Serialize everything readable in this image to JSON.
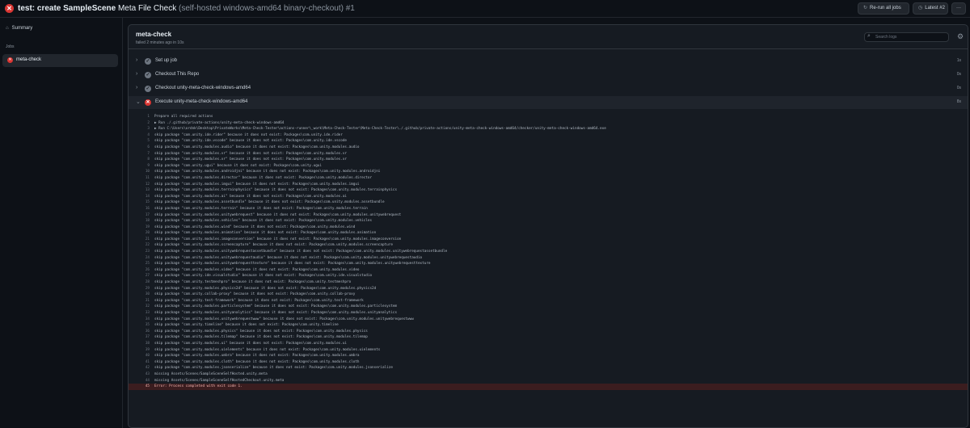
{
  "header": {
    "title_bold": "test: create SampleScene",
    "title_rest": "Meta File Check",
    "title_muted": "(self-hosted windows-amd64 binary-checkout) #1",
    "rerun_label": "Re-run all jobs",
    "latest_label": "Latest #2",
    "more_label": "···"
  },
  "sidebar": {
    "summary_label": "Summary",
    "jobs_label": "Jobs",
    "job_label": "meta-check"
  },
  "job": {
    "title": "meta-check",
    "subtitle": "failed 2 minutes ago in 10s",
    "search_placeholder": "Search logs"
  },
  "steps": [
    {
      "name": "Set up job",
      "duration": "1s",
      "status": "success"
    },
    {
      "name": "Checkout This Repo",
      "duration": "0s",
      "status": "success"
    },
    {
      "name": "Checkout unity-meta-check-windows-amd64",
      "duration": "0s",
      "status": "success"
    },
    {
      "name": "Execute unity-meta-check-windows-amd64",
      "duration": "8s",
      "status": "failure"
    }
  ],
  "log_lines": [
    "Prepare all required actions",
    "▶ Run ./.github/private-actions/unity-meta-check-windows-amd64",
    "▶ Run C:\\Users\\ordnk\\Desktop\\PrivateWorks\\Meta-Check-Tester\\actions-runner\\_work\\Meta-Check-Tester\\Meta-Check-Tester\\./.github/private-actions/unity-meta-check-windows-amd64/checker/unity-meta-check-windows-amd64.exe",
    "skip package \"com.unity.ide.rider\" because it does not exist: Packages\\com.unity.ide.rider",
    "skip package \"com.unity.ide.vscode\" because it does not exist: Packages\\com.unity.ide.vscode",
    "skip package \"com.unity.modules.audio\" because it does not exist: Packages\\com.unity.modules.audio",
    "skip package \"com.unity.modules.vr\" because it does not exist: Packages\\com.unity.modules.vr",
    "skip package \"com.unity.modules.xr\" because it does not exist: Packages\\com.unity.modules.xr",
    "skip package \"com.unity.ugui\" because it does not exist: Packages\\com.unity.ugui",
    "skip package \"com.unity.modules.androidjni\" because it does not exist: Packages\\com.unity.modules.androidjni",
    "skip package \"com.unity.modules.director\" because it does not exist: Packages\\com.unity.modules.director",
    "skip package \"com.unity.modules.imgui\" because it does not exist: Packages\\com.unity.modules.imgui",
    "skip package \"com.unity.modules.terrainphysics\" because it does not exist: Packages\\com.unity.modules.terrainphysics",
    "skip package \"com.unity.modules.ai\" because it does not exist: Packages\\com.unity.modules.ai",
    "skip package \"com.unity.modules.assetbundle\" because it does not exist: Packages\\com.unity.modules.assetbundle",
    "skip package \"com.unity.modules.terrain\" because it does not exist: Packages\\com.unity.modules.terrain",
    "skip package \"com.unity.modules.unitywebrequest\" because it does not exist: Packages\\com.unity.modules.unitywebrequest",
    "skip package \"com.unity.modules.vehicles\" because it does not exist: Packages\\com.unity.modules.vehicles",
    "skip package \"com.unity.modules.wind\" because it does not exist: Packages\\com.unity.modules.wind",
    "skip package \"com.unity.modules.animation\" because it does not exist: Packages\\com.unity.modules.animation",
    "skip package \"com.unity.modules.imageconversion\" because it does not exist: Packages\\com.unity.modules.imageconversion",
    "skip package \"com.unity.modules.screencapture\" because it does not exist: Packages\\com.unity.modules.screencapture",
    "skip package \"com.unity.modules.unitywebrequestassetbundle\" because it does not exist: Packages\\com.unity.modules.unitywebrequestassetbundle",
    "skip package \"com.unity.modules.unitywebrequestaudio\" because it does not exist: Packages\\com.unity.modules.unitywebrequestaudio",
    "skip package \"com.unity.modules.unitywebrequesttexture\" because it does not exist: Packages\\com.unity.modules.unitywebrequesttexture",
    "skip package \"com.unity.modules.video\" because it does not exist: Packages\\com.unity.modules.video",
    "skip package \"com.unity.ide.visualstudio\" because it does not exist: Packages\\com.unity.ide.visualstudio",
    "skip package \"com.unity.testmeshpro\" because it does not exist: Packages\\com.unity.testmeshpro",
    "skip package \"com.unity.modules.physics2d\" because it does not exist: Packages\\com.unity.modules.physics2d",
    "skip package \"com.unity.collab-proxy\" because it does not exist: Packages\\com.unity.collab-proxy",
    "skip package \"com.unity.test-framework\" because it does not exist: Packages\\com.unity.test-framework",
    "skip package \"com.unity.modules.particlesystem\" because it does not exist: Packages\\com.unity.modules.particlesystem",
    "skip package \"com.unity.modules.unityanalytics\" because it does not exist: Packages\\com.unity.modules.unityanalytics",
    "skip package \"com.unity.modules.unitywebrequestwww\" because it does not exist: Packages\\com.unity.modules.unitywebrequestwww",
    "skip package \"com.unity.timeline\" because it does not exist: Packages\\com.unity.timeline",
    "skip package \"com.unity.modules.physics\" because it does not exist: Packages\\com.unity.modules.physics",
    "skip package \"com.unity.modules.tilemap\" because it does not exist: Packages\\com.unity.modules.tilemap",
    "skip package \"com.unity.modules.ui\" because it does not exist: Packages\\com.unity.modules.ui",
    "skip package \"com.unity.modules.uielements\" because it does not exist: Packages\\com.unity.modules.uielements",
    "skip package \"com.unity.modules.umbra\" because it does not exist: Packages\\com.unity.modules.umbra",
    "skip package \"com.unity.modules.cloth\" because it does not exist: Packages\\com.unity.modules.cloth",
    "skip package \"com.unity.modules.jsonserialize\" because it does not exist: Packages\\com.unity.modules.jsonserialize",
    "missing Assets/Scenes/SampleSceneSelfHosted.unity.meta",
    "missing Assets/Scenes/SampleSceneSelfHostedCheckout.unity.meta",
    "Error: Process completed with exit code 1."
  ],
  "colors": {
    "background": "#0d1117",
    "panel": "#161b22",
    "failure": "#da3633",
    "success": "#6e7681",
    "error_row": "#3b1d1f"
  }
}
